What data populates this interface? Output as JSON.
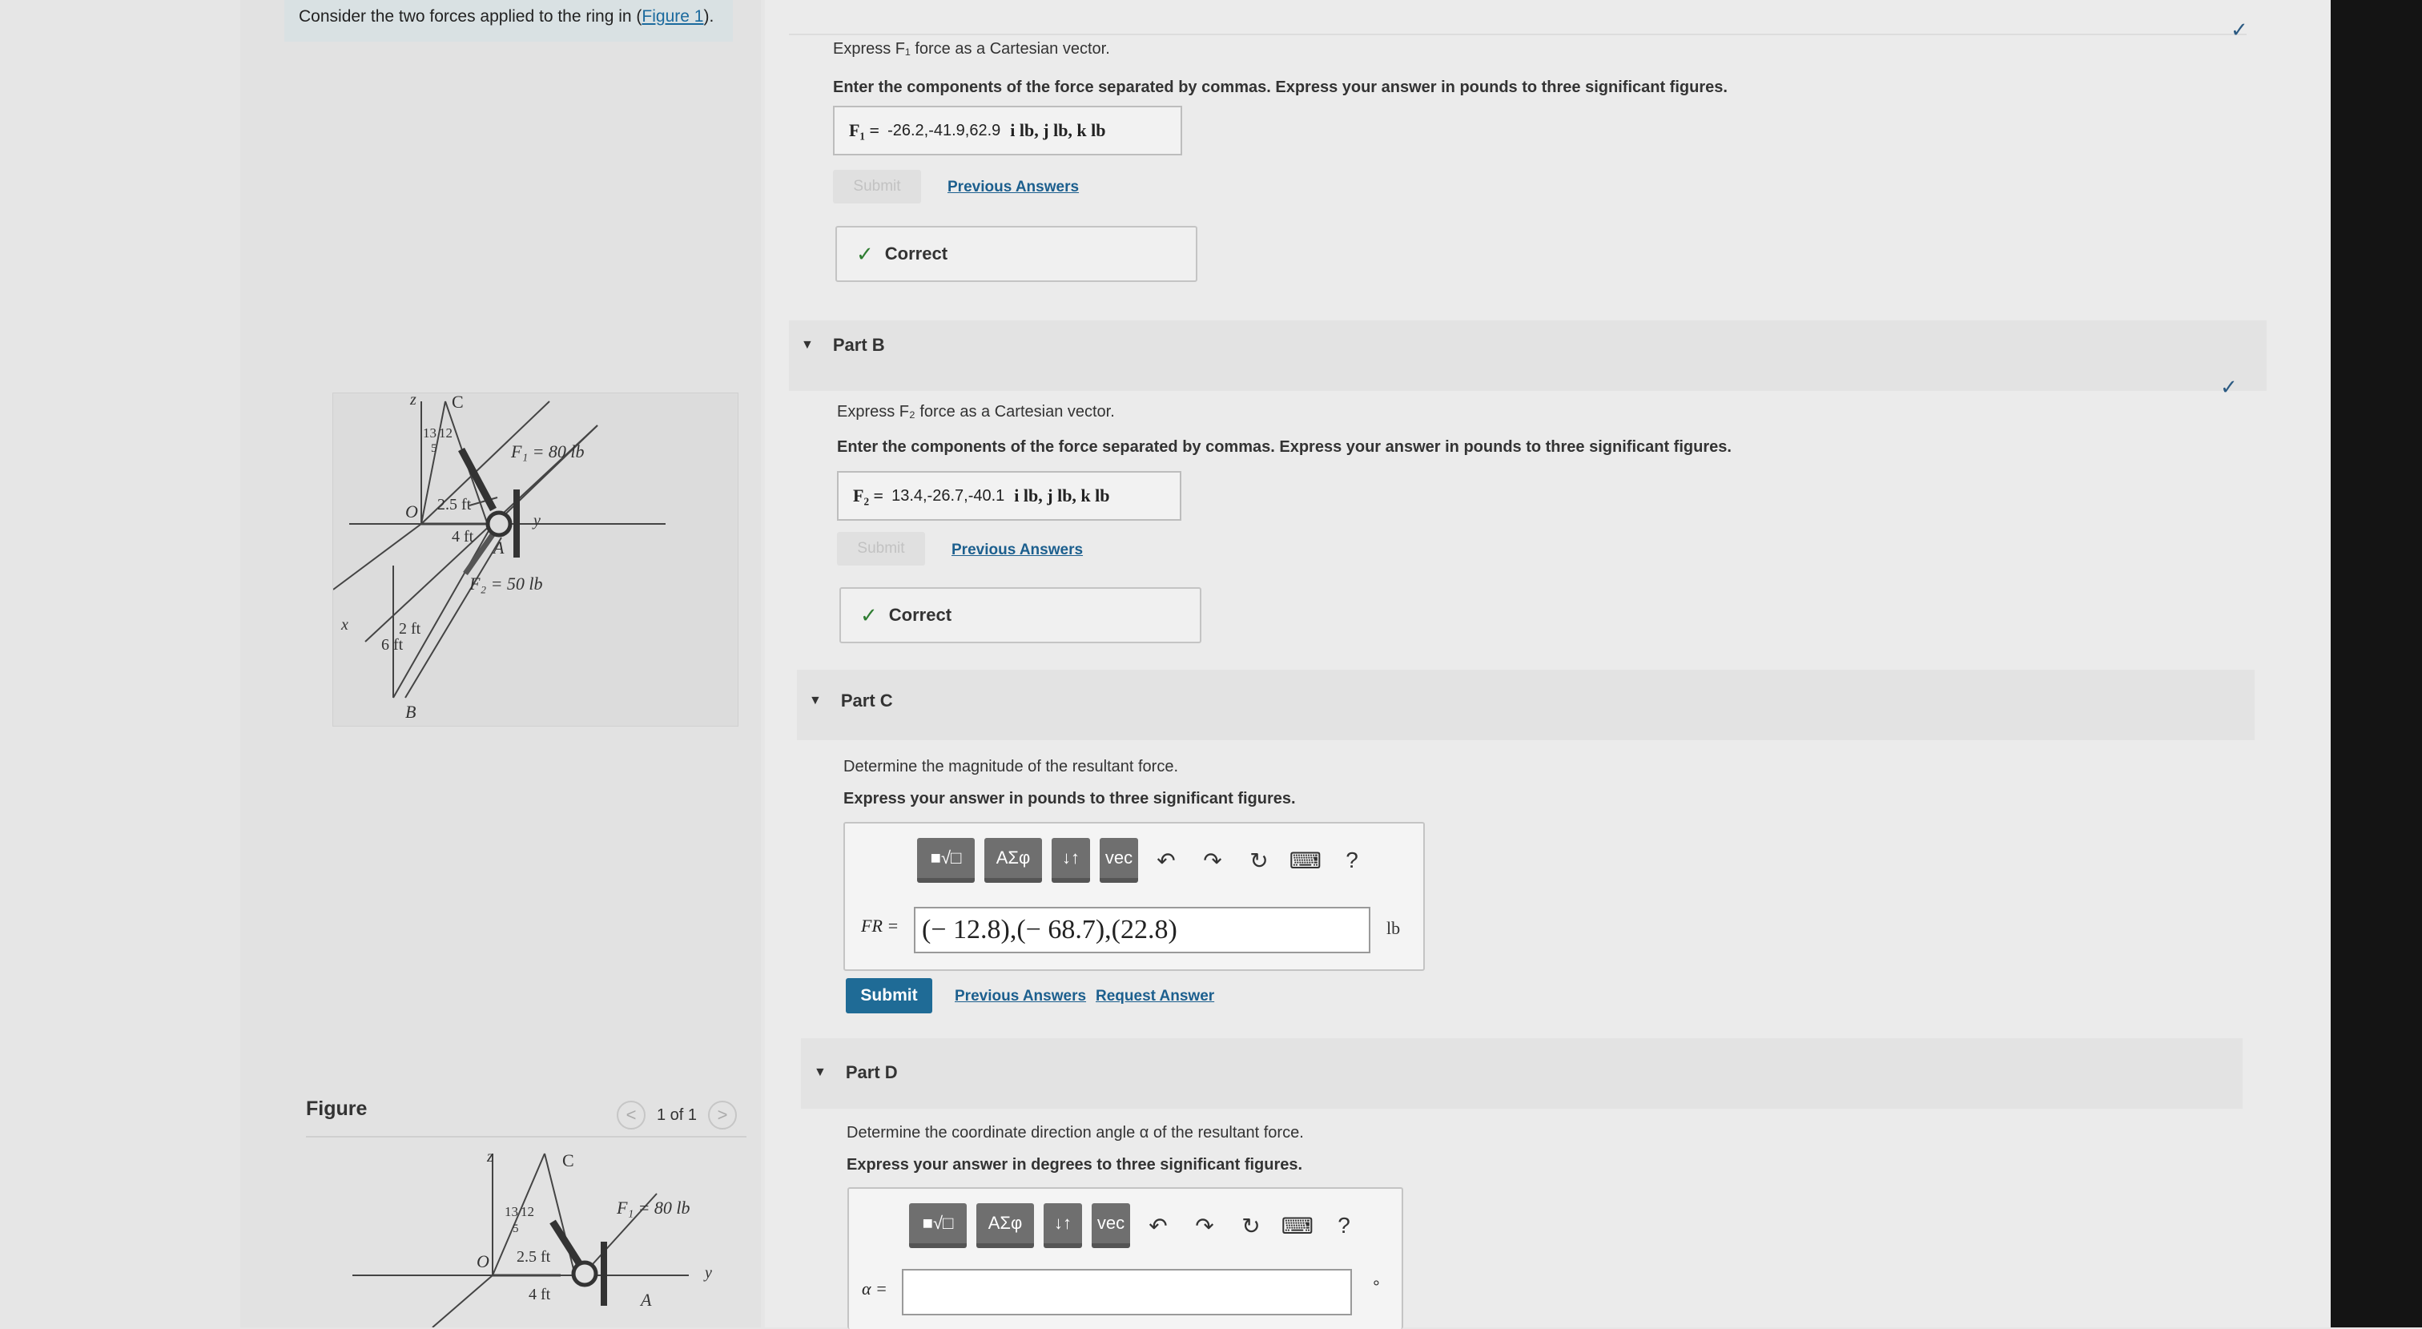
{
  "prompt": {
    "text": "Consider the two forces applied to the ring in (",
    "link": "Figure 1",
    "tail": ")."
  },
  "figure_labels": {
    "z": "z",
    "x": "x",
    "y": "y",
    "C": "C",
    "O": "O",
    "A": "A",
    "B": "B",
    "r13": "13",
    "r12": "12",
    "r5": "5",
    "f1": "F₁ = 80 lb",
    "f2": "F₂ = 50 lb",
    "d25": "2.5 ft",
    "d4": "4 ft",
    "d2": "2 ft",
    "d6": "6 ft"
  },
  "figure_panel": {
    "title": "Figure",
    "pager": "1 of 1",
    "prev": "<",
    "next": ">"
  },
  "partA": {
    "instr1": "Express F₁ force as a Cartesian vector.",
    "instr2": "Enter the components of the force separated by commas. Express your answer in pounds to three significant figures.",
    "label": "F₁ =",
    "value": "-26.2,-41.9,62.9",
    "units": "i lb, j lb, k lb",
    "submit": "Submit",
    "prev": "Previous Answers",
    "status": "Correct"
  },
  "partB": {
    "title": "Part B",
    "instr1": "Express F₂ force as a Cartesian vector.",
    "instr2": "Enter the components of the force separated by commas. Express your answer in pounds to three significant figures.",
    "label": "F₂ =",
    "value": "13.4,-26.7,-40.1",
    "units": "i lb, j lb, k lb",
    "submit": "Submit",
    "prev": "Previous Answers",
    "status": "Correct"
  },
  "partC": {
    "title": "Part C",
    "instr1": "Determine the magnitude of the resultant force.",
    "instr2": "Express your answer in pounds to three significant figures.",
    "label": "FR =",
    "value": "(− 12.8),(− 68.7),(22.8)",
    "unit": "lb",
    "submit": "Submit",
    "prev": "Previous Answers",
    "request": "Request Answer"
  },
  "partD": {
    "title": "Part D",
    "instr1": "Determine the coordinate direction angle α of the resultant force.",
    "instr2": "Express your answer in degrees to three significant figures.",
    "label": "α =",
    "value": "",
    "unit": "°"
  },
  "toolbar": {
    "templates": "■√□",
    "greek": "AΣφ",
    "arrows": "↓↑",
    "vec": "vec",
    "undo": "↶",
    "redo": "↷",
    "reset": "↻",
    "keyboard": "⌨",
    "help": "?"
  },
  "checks": {
    "a": "✓",
    "b": "✓"
  },
  "colors": {
    "submit": "#1f6b96",
    "link": "#1c5f8e",
    "correct": "#2f7d32",
    "check": "#2b5a82"
  }
}
